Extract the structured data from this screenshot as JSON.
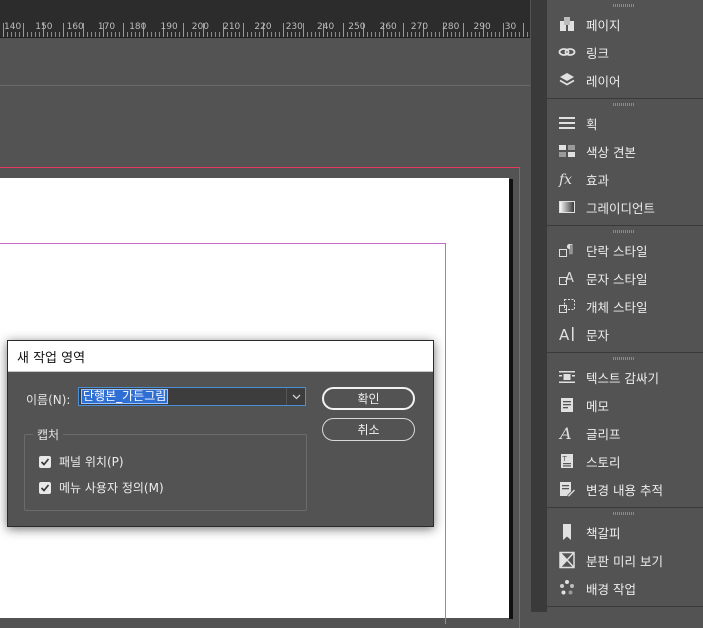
{
  "ruler": {
    "labels": [
      "140",
      "150",
      "160",
      "170",
      "180",
      "190",
      "200",
      "210",
      "220",
      "230",
      "240",
      "250",
      "260",
      "270",
      "280",
      "290",
      "30"
    ]
  },
  "panel": {
    "groups": [
      [
        {
          "label": "페이지",
          "icon": "pages-icon"
        },
        {
          "label": "링크",
          "icon": "links-icon"
        },
        {
          "label": "레이어",
          "icon": "layers-icon"
        }
      ],
      [
        {
          "label": "획",
          "icon": "stroke-icon"
        },
        {
          "label": "색상 견본",
          "icon": "swatches-icon"
        },
        {
          "label": "효과",
          "icon": "effects-icon"
        },
        {
          "label": "그레이디언트",
          "icon": "gradient-icon"
        }
      ],
      [
        {
          "label": "단락 스타일",
          "icon": "paragraph-styles-icon"
        },
        {
          "label": "문자 스타일",
          "icon": "character-styles-icon"
        },
        {
          "label": "개체 스타일",
          "icon": "object-styles-icon"
        },
        {
          "label": "문자",
          "icon": "character-icon"
        }
      ],
      [
        {
          "label": "텍스트 감싸기",
          "icon": "text-wrap-icon"
        },
        {
          "label": "메모",
          "icon": "notes-icon"
        },
        {
          "label": "글리프",
          "icon": "glyphs-icon"
        },
        {
          "label": "스토리",
          "icon": "story-icon"
        },
        {
          "label": "변경 내용 추적",
          "icon": "track-changes-icon"
        }
      ],
      [
        {
          "label": "책갈피",
          "icon": "bookmarks-icon"
        },
        {
          "label": "분판 미리 보기",
          "icon": "separations-preview-icon"
        },
        {
          "label": "배경 작업",
          "icon": "background-tasks-icon"
        }
      ]
    ]
  },
  "dialog": {
    "title": "새 작업 영역",
    "name_label": "이름(N):",
    "name_value": "단행본_가든그림",
    "capture_label": "캡처",
    "checkbox_panel_position": {
      "label": "패널 위치(P)",
      "checked": true
    },
    "checkbox_menu_custom": {
      "label": "메뉴 사용자 정의(M)",
      "checked": true
    },
    "ok_label": "확인",
    "cancel_label": "취소"
  },
  "colors": {
    "ui_bg": "#535353",
    "ruler_bg": "#2c2c2c",
    "bleed_guide": "#e6385e",
    "margin_guide": "#c86bc8",
    "selection": "#2f6fd4"
  }
}
